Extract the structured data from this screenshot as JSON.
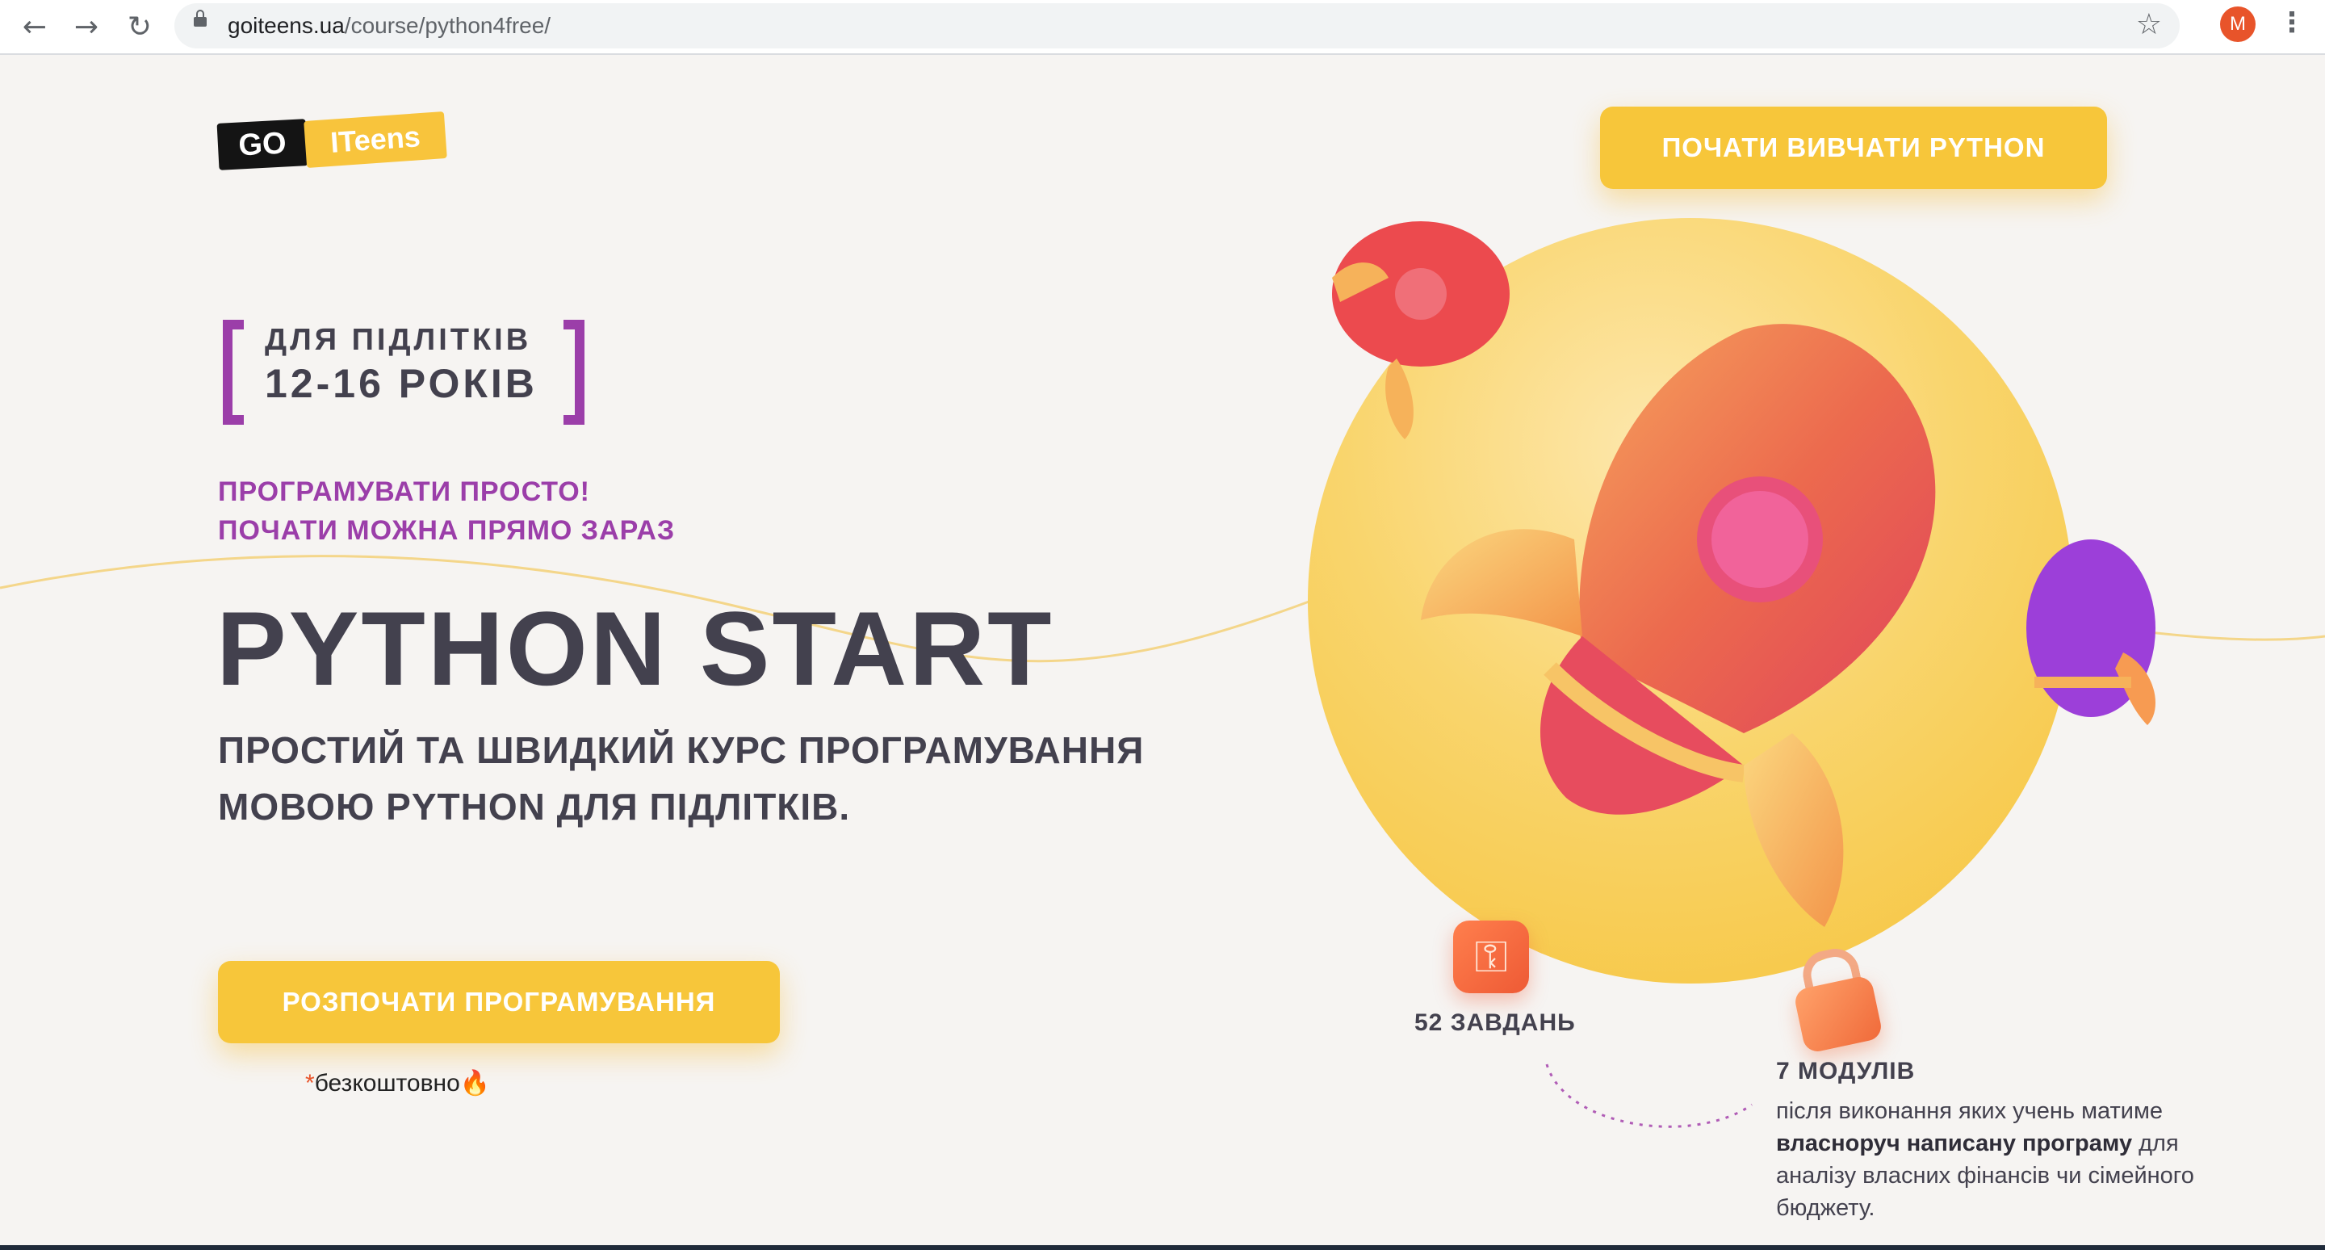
{
  "browser": {
    "url_domain": "goiteens.ua",
    "url_path": "/course/python4free/",
    "back_icon": "←",
    "forward_icon": "→",
    "reload_icon": "↻",
    "bookmark_icon": "☆",
    "profile_initial": "M",
    "menu_icon": "⋮"
  },
  "header": {
    "logo_go": "GO",
    "logo_teens": "ITeens",
    "cta_label": "ПОЧАТИ ВИВЧАТИ PYTHON"
  },
  "hero": {
    "age_line1": "ДЛЯ ПІДЛІТКІВ",
    "age_line2": "12-16 РОКІВ",
    "slogan_line1": "ПРОГРАМУВАТИ ПРОСТО!",
    "slogan_line2": "ПОЧАТИ МОЖНА ПРЯМО ЗАРАЗ",
    "title": "PYTHON START",
    "subtitle_line1": "ПРОСТИЙ ТА ШВИДКИЙ КУРС ПРОГРАМУВАННЯ",
    "subtitle_line2": "МОВОЮ PYTHON ДЛЯ ПІДЛІТКІВ.",
    "cta_label": "РОЗПОЧАТИ ПРОГРАМУВАННЯ",
    "free_asterisk": "*",
    "free_text": "безкоштовно🔥"
  },
  "stats": {
    "tasks_label": "52 ЗАВДАНЬ",
    "modules_label": "7 МОДУЛІВ",
    "modules_desc_part1": "після виконання яких учень матиме ",
    "modules_desc_bold": "власноруч написану програму",
    "modules_desc_part2": " для аналізу власних фінансів чи сімейного бюджету."
  },
  "colors": {
    "accent_yellow": "#f7c63a",
    "accent_purple": "#9b3ea9",
    "text_dark": "#43414e",
    "background": "#f6f4f2"
  }
}
